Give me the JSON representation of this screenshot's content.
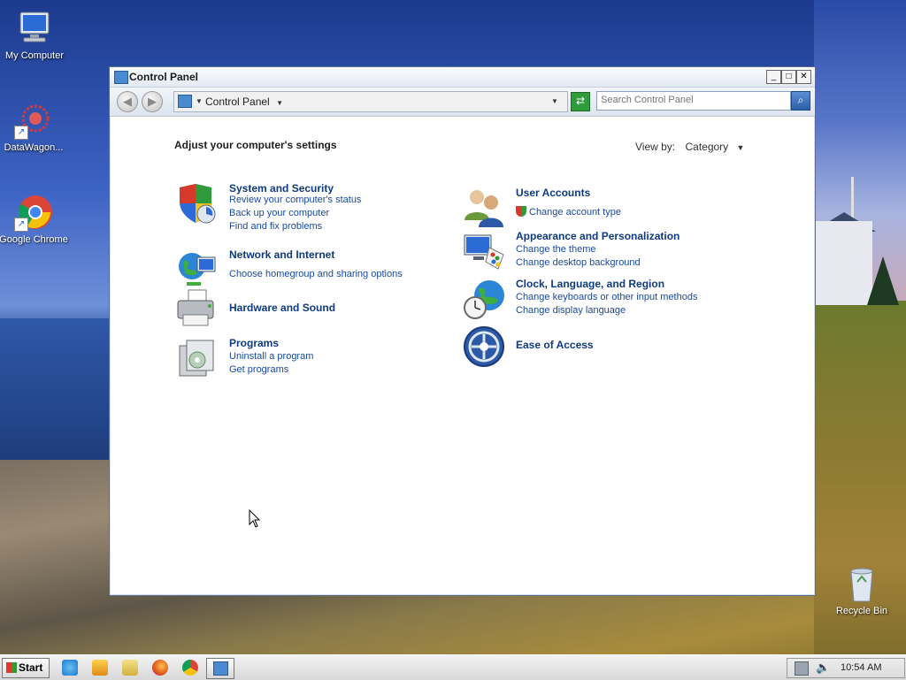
{
  "desktop": {
    "icons": [
      {
        "label": "My Computer"
      },
      {
        "label": "DataWagon..."
      },
      {
        "label": "Google Chrome"
      },
      {
        "label": "Recycle Bin"
      }
    ]
  },
  "window": {
    "title": "Control Panel",
    "controls": {
      "minimize": "_",
      "maximize": "□",
      "close": "✕"
    },
    "address": {
      "crumb": "Control Panel"
    },
    "search": {
      "placeholder": "Search Control Panel"
    }
  },
  "content": {
    "heading": "Adjust your computer's settings",
    "view_by": {
      "label": "View by:",
      "value": "Category"
    },
    "categories_left": [
      {
        "title": "System and Security",
        "icon": "shield-icon",
        "links": [
          "Review your computer's status",
          "Back up your computer",
          "Find and fix problems"
        ]
      },
      {
        "title": "Network and Internet",
        "icon": "network-globe-icon",
        "links": [
          "Choose homegroup and sharing options"
        ]
      },
      {
        "title": "Hardware and Sound",
        "icon": "printer-icon",
        "links": []
      },
      {
        "title": "Programs",
        "icon": "programs-box-icon",
        "links": [
          "Uninstall a program",
          "Get programs"
        ]
      }
    ],
    "categories_right": [
      {
        "title": "User Accounts",
        "icon": "users-icon",
        "links": [
          "Change account type"
        ]
      },
      {
        "title": "Appearance and Personalization",
        "icon": "monitor-palette-icon",
        "links": [
          "Change the theme",
          "Change desktop background"
        ]
      },
      {
        "title": "Clock, Language, and Region",
        "icon": "globe-clock-icon",
        "links": [
          "Change keyboards or other input methods",
          "Change display language"
        ]
      },
      {
        "title": "Ease of Access",
        "icon": "ease-of-access-icon",
        "links": []
      }
    ]
  },
  "taskbar": {
    "start_label": "Start",
    "clock": "10:54 AM"
  }
}
